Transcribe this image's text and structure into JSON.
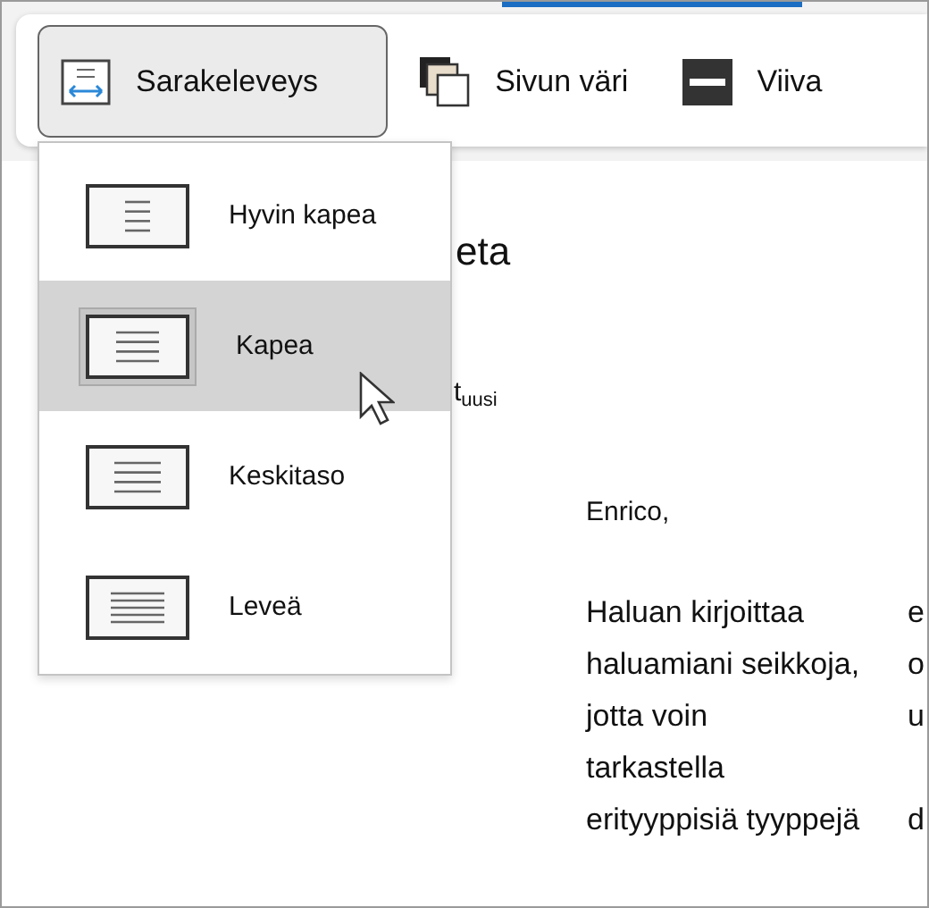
{
  "ribbon": {
    "buttons": [
      {
        "label": "Sarakeleveys",
        "kind": "column-width",
        "expanded": true
      },
      {
        "label": "Sivun väri",
        "kind": "page-color",
        "expanded": false
      },
      {
        "label": "Viiva",
        "kind": "line",
        "expanded": false
      }
    ]
  },
  "column_width_menu": {
    "items": [
      {
        "label": "Hyvin kapea",
        "selected": false
      },
      {
        "label": "Kapea",
        "selected": true
      },
      {
        "label": "Keskitaso",
        "selected": false
      },
      {
        "label": "Leveä",
        "selected": false
      }
    ]
  },
  "document": {
    "heading": "eta",
    "subtitle": "t$_{uusi}$",
    "greeting": "Enrico,",
    "rows": [
      {
        "column_1": "Haluan kirjoittaa",
        "column_2": "e"
      },
      {
        "column_1": "haluamiani seikkoja,",
        "column_2": "o"
      },
      {
        "column_1": "jotta voin",
        "column_2": "u"
      },
      {
        "column_1": "tarkastella"
      },
      {
        "column_1": "erityyppisiä tyyppejä",
        "column_2": "d"
      }
    ]
  }
}
